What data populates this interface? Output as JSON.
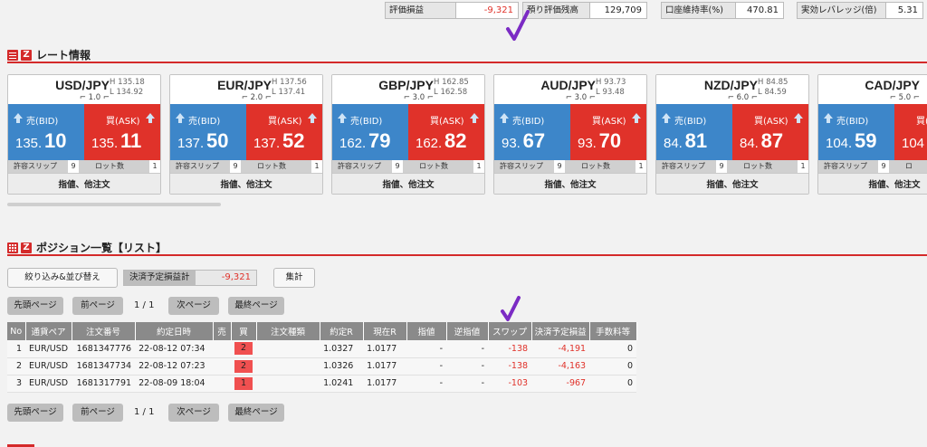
{
  "stats": [
    {
      "label": "評価損益",
      "value": "-9,321",
      "negative": true
    },
    {
      "label": "預り評価残高",
      "value": "129,709",
      "negative": false
    },
    {
      "label": "口座維持率(%)",
      "value": "470.81",
      "negative": false
    },
    {
      "label": "実効レバレッジ(倍)",
      "value": "5.31",
      "negative": false
    }
  ],
  "rate_section": {
    "title": "レート情報"
  },
  "cards": [
    {
      "pair": "USD/JPY",
      "high": "H 135.18",
      "low": "L 134.92",
      "spread": "1.0",
      "bid_small": "135.",
      "bid_big": "10",
      "ask_small": "135.",
      "ask_big": "11",
      "slip_label": "許容スリップ",
      "slip_value": "9",
      "lot_label": "ロット数",
      "lot_value": "1",
      "order_label": "指値、他注文"
    },
    {
      "pair": "EUR/JPY",
      "high": "H 137.56",
      "low": "L 137.41",
      "spread": "2.0",
      "bid_small": "137.",
      "bid_big": "50",
      "ask_small": "137.",
      "ask_big": "52",
      "slip_label": "許容スリップ",
      "slip_value": "9",
      "lot_label": "ロット数",
      "lot_value": "1",
      "order_label": "指値、他注文"
    },
    {
      "pair": "GBP/JPY",
      "high": "H 162.85",
      "low": "L 162.58",
      "spread": "3.0",
      "bid_small": "162.",
      "bid_big": "79",
      "ask_small": "162.",
      "ask_big": "82",
      "slip_label": "許容スリップ",
      "slip_value": "9",
      "lot_label": "ロット数",
      "lot_value": "1",
      "order_label": "指値、他注文"
    },
    {
      "pair": "AUD/JPY",
      "high": "H 93.73",
      "low": "L 93.48",
      "spread": "3.0",
      "bid_small": "93.",
      "bid_big": "67",
      "ask_small": "93.",
      "ask_big": "70",
      "slip_label": "許容スリップ",
      "slip_value": "9",
      "lot_label": "ロット数",
      "lot_value": "1",
      "order_label": "指値、他注文"
    },
    {
      "pair": "NZD/JPY",
      "high": "H 84.85",
      "low": "L 84.59",
      "spread": "6.0",
      "bid_small": "84.",
      "bid_big": "81",
      "ask_small": "84.",
      "ask_big": "87",
      "slip_label": "許容スリップ",
      "slip_value": "9",
      "lot_label": "ロット数",
      "lot_value": "1",
      "order_label": "指値、他注文"
    },
    {
      "pair": "CAD/JPY",
      "high": "",
      "low": "",
      "spread": "5.0",
      "bid_small": "104.",
      "bid_big": "59",
      "ask_small": "104",
      "ask_big": "",
      "slip_label": "許容スリップ",
      "slip_value": "9",
      "lot_label": "ロ",
      "lot_value": "",
      "order_label": "指値、他注文"
    }
  ],
  "bid_label": "売(BID)",
  "ask_label": "買(ASK)",
  "position_section": {
    "title": "ポジション一覧【リスト】"
  },
  "controls": {
    "filter_button": "絞り込み&並び替え",
    "pnl_label": "決済予定損益計",
    "pnl_value": "-9,321",
    "aggregate_button": "集計"
  },
  "pager": {
    "first": "先頭ページ",
    "prev": "前ページ",
    "page_text": "1 / 1",
    "next": "次ページ",
    "last": "最終ページ"
  },
  "table": {
    "headers": [
      "No",
      "通貨ペア",
      "注文番号",
      "約定日時",
      "売",
      "買",
      "注文種類",
      "約定R",
      "現在R",
      "指値",
      "逆指値",
      "スワップ",
      "決済予定損益",
      "手数料等"
    ],
    "rows": [
      {
        "no": "1",
        "pair": "EUR/USD",
        "order": "1681347776",
        "date": "22-08-12 07:34",
        "sell": "",
        "buy": "2",
        "type": "",
        "rate": "1.0327",
        "current": "1.0177",
        "limit": "-",
        "stop": "-",
        "swap": "-138",
        "pnl": "-4,191",
        "fee": "0"
      },
      {
        "no": "2",
        "pair": "EUR/USD",
        "order": "1681347734",
        "date": "22-08-12 07:23",
        "sell": "",
        "buy": "2",
        "type": "",
        "rate": "1.0326",
        "current": "1.0177",
        "limit": "-",
        "stop": "-",
        "swap": "-138",
        "pnl": "-4,163",
        "fee": "0"
      },
      {
        "no": "3",
        "pair": "EUR/USD",
        "order": "1681317791",
        "date": "22-08-09 18:04",
        "sell": "",
        "buy": "1",
        "type": "",
        "rate": "1.0241",
        "current": "1.0177",
        "limit": "-",
        "stop": "-",
        "swap": "-103",
        "pnl": "-967",
        "fee": "0"
      }
    ]
  },
  "colors": {
    "accent": "#d42a2a",
    "bid": "#3d86c9",
    "ask": "#e0322a",
    "annotation": "#7b2bc4"
  }
}
